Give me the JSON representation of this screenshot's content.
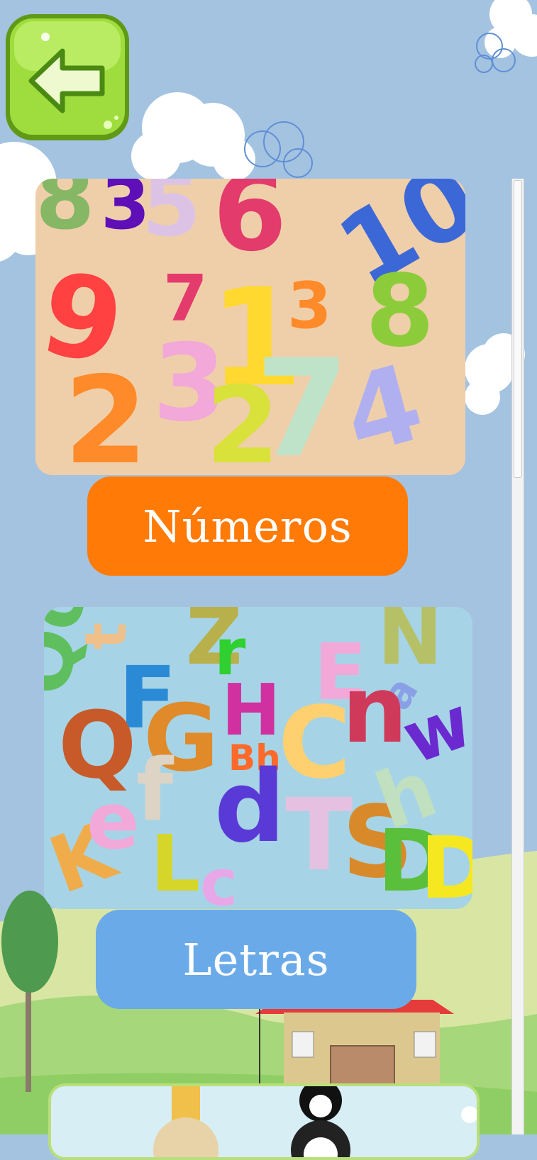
{
  "menu": {
    "numbers_button": "Números",
    "letters_button": "Letras"
  },
  "icons": {
    "back": "arrow-left-icon"
  },
  "colors": {
    "sky": "#a4c3e0",
    "back_button": "#9fdc3d",
    "numbers_button": "#ff7a07",
    "letters_button": "#6aaae8",
    "numbers_card": "#efcfaa",
    "letters_card": "#a6d4e6"
  }
}
